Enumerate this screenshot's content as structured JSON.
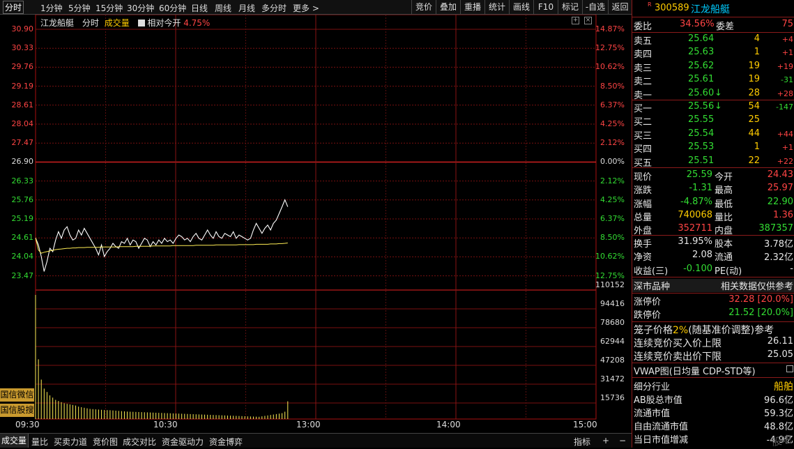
{
  "toolbar": {
    "tabs": [
      "分时",
      "1分钟",
      "5分钟",
      "15分钟",
      "30分钟",
      "60分钟",
      "日线",
      "周线",
      "月线",
      "多分时",
      "更多 >"
    ],
    "right": [
      "竞价",
      "叠加",
      "重播",
      "统计",
      "画线",
      "F10",
      "标记",
      "-自选",
      "返回"
    ]
  },
  "chart_header": {
    "name": "江龙船艇",
    "mode": "分时",
    "volume_label": "成交量",
    "relative_label": "相对今开",
    "relative_value": "4.75%"
  },
  "price_axis": [
    "30.90",
    "30.33",
    "29.76",
    "29.19",
    "28.61",
    "28.04",
    "27.47",
    "26.90",
    "26.33",
    "25.76",
    "25.19",
    "24.61",
    "24.04",
    "23.47"
  ],
  "pct_axis": [
    "14.87%",
    "12.75%",
    "10.62%",
    "8.50%",
    "6.37%",
    "4.25%",
    "2.12%",
    "0.00%",
    "2.12%",
    "4.25%",
    "6.37%",
    "8.50%",
    "10.62%",
    "12.75%"
  ],
  "volume_axis": [
    "110152",
    "94416",
    "78680",
    "62944",
    "47208",
    "31472",
    "15736"
  ],
  "time_axis": [
    "09:30",
    "10:30",
    "13:00",
    "14:00",
    "15:00"
  ],
  "side_buttons": [
    "国信微信",
    "国信股搜"
  ],
  "bottom_tabs": [
    "成交量",
    "量比",
    "买卖力道",
    "竞价图",
    "成交对比",
    "资金驱动力",
    "资金博弈"
  ],
  "bottom_right": [
    "指标",
    "+",
    "−"
  ],
  "chart_data": {
    "type": "line",
    "x_range": [
      "09:30",
      "15:00"
    ],
    "ylim": [
      23.47,
      30.9
    ],
    "prev_close": 26.9,
    "series": [
      {
        "values": [
          24.61,
          24.4,
          24.05,
          23.6,
          23.9,
          24.3,
          24.2,
          24.55,
          24.8,
          24.6,
          24.85,
          24.95,
          24.7,
          24.55,
          24.6,
          24.85,
          24.7,
          24.9,
          24.75,
          24.6,
          24.45,
          24.3,
          24.1,
          24.4,
          24.05,
          24.2,
          24.3,
          24.45,
          24.35,
          24.3,
          24.5,
          24.45,
          24.6,
          24.4,
          24.55,
          24.5,
          24.3,
          24.45,
          24.6,
          24.55,
          24.35,
          24.5,
          24.4,
          24.55,
          24.45,
          24.6,
          24.5,
          24.55,
          24.45,
          24.6,
          24.7,
          24.65,
          24.55,
          24.6,
          24.5,
          24.65,
          24.75,
          24.6,
          24.55,
          24.7,
          24.85,
          24.7,
          24.6,
          24.8,
          24.65,
          24.6,
          24.75,
          24.7,
          24.65,
          24.8,
          24.6,
          24.7,
          24.65,
          24.6,
          24.55,
          24.6,
          24.85,
          25.05,
          24.9,
          24.75,
          24.9,
          25.0,
          24.85,
          25.05,
          25.15,
          25.35,
          25.55,
          25.76,
          25.55
        ]
      },
      {
        "values": [
          24.61,
          24.25,
          24.15,
          24.18,
          24.2,
          24.22,
          24.24,
          24.26,
          24.27,
          24.28,
          24.29,
          24.3,
          24.3,
          24.31,
          24.31,
          24.32,
          24.32,
          24.32,
          24.33,
          24.33,
          24.33,
          24.33,
          24.33,
          24.34,
          24.34,
          24.34,
          24.34,
          24.34,
          24.34,
          24.35,
          24.35,
          24.35,
          24.35,
          24.35,
          24.35,
          24.36,
          24.36,
          24.36,
          24.36,
          24.36,
          24.36,
          24.37,
          24.37,
          24.37,
          24.37,
          24.37,
          24.37,
          24.37,
          24.38,
          24.38,
          24.38,
          24.38,
          24.38,
          24.38,
          24.38,
          24.38,
          24.39,
          24.39,
          24.39,
          24.39,
          24.39,
          24.39,
          24.39,
          24.4,
          24.4,
          24.4,
          24.4,
          24.4,
          24.4,
          24.4,
          24.4,
          24.41,
          24.41,
          24.41,
          24.41,
          24.41,
          24.41,
          24.42,
          24.42,
          24.42,
          24.42,
          24.42,
          24.43,
          24.43,
          24.43,
          24.44,
          24.44,
          24.45,
          24.46
        ]
      }
    ],
    "volume": [
      110152,
      53000,
      35000,
      27000,
      24000,
      21000,
      19000,
      17000,
      16000,
      15000,
      14000,
      13500,
      13000,
      12500,
      12000,
      11000,
      10500,
      10000,
      9500,
      9000,
      8800,
      8600,
      8400,
      8200,
      8000,
      7900,
      7800,
      7600,
      7400,
      7200,
      7000,
      6800,
      6600,
      6500,
      6400,
      6300,
      6200,
      6100,
      6000,
      5900,
      5800,
      5700,
      5600,
      5500,
      5400,
      5300,
      5200,
      5100,
      5000,
      4900,
      4800,
      4700,
      4600,
      4500,
      4400,
      4300,
      4200,
      4100,
      4000,
      3900,
      3800,
      3700,
      3600,
      3500,
      3400,
      3300,
      3200,
      3100,
      3000,
      2900,
      2800,
      2700,
      2600,
      2500,
      2400,
      2300,
      2200,
      2100,
      2000,
      2400,
      2800,
      3200,
      3600,
      4000,
      4400,
      4800,
      5200,
      6500,
      15736
    ],
    "ylim_volume": [
      0,
      110152
    ]
  },
  "panel": {
    "code_prefix": "R",
    "code": "300589",
    "name": "江龙船艇",
    "weibi_label": "委比",
    "weibi_value": "34.56%",
    "weicha_label": "委差",
    "weicha_value": "75",
    "sells": [
      {
        "label": "卖五",
        "price": "25.64",
        "vol": "4",
        "chg": "+4"
      },
      {
        "label": "卖四",
        "price": "25.63",
        "vol": "1",
        "chg": "+1"
      },
      {
        "label": "卖三",
        "price": "25.62",
        "vol": "19",
        "chg": "+19"
      },
      {
        "label": "卖二",
        "price": "25.61",
        "vol": "19",
        "chg": "-31"
      },
      {
        "label": "卖一",
        "price": "25.60",
        "vol": "28",
        "chg": "+28",
        "arrow": "↓"
      }
    ],
    "buys": [
      {
        "label": "买一",
        "price": "25.56",
        "vol": "54",
        "chg": "-147",
        "arrow": "↓"
      },
      {
        "label": "买二",
        "price": "25.55",
        "vol": "25",
        "chg": ""
      },
      {
        "label": "买三",
        "price": "25.54",
        "vol": "44",
        "chg": "+44"
      },
      {
        "label": "买四",
        "price": "25.53",
        "vol": "1",
        "chg": "+1"
      },
      {
        "label": "买五",
        "price": "25.51",
        "vol": "22",
        "chg": "+22"
      }
    ],
    "quote": [
      {
        "l1": "现价",
        "v1": "25.59",
        "l2": "今开",
        "v2": "24.43"
      },
      {
        "l1": "涨跌",
        "v1": "-1.31",
        "l2": "最高",
        "v2": "25.97"
      },
      {
        "l1": "涨幅",
        "v1": "-4.87%",
        "l2": "最低",
        "v2": "22.90"
      },
      {
        "l1": "总量",
        "v1": "740068",
        "l2": "量比",
        "v2": "1.36"
      },
      {
        "l1": "外盘",
        "v1": "352711",
        "l2": "内盘",
        "v2": "387357"
      }
    ],
    "finance": [
      {
        "l1": "换手",
        "v1": "31.95%",
        "l2": "股本",
        "v2": "3.78亿"
      },
      {
        "l1": "净资",
        "v1": "2.08",
        "l2": "流通",
        "v2": "2.32亿"
      },
      {
        "l1": "收益(三)",
        "v1": "-0.100",
        "l2": "PE(动)",
        "v2": "-"
      }
    ],
    "market_label": "深市品种",
    "ref_label": "相关数据仅供参考",
    "limit_up_label": "涨停价",
    "limit_up_value": "32.28 [20.0%]",
    "limit_down_label": "跌停价",
    "limit_down_value": "21.52 [20.0%]",
    "cage_label": "笼子价格",
    "cage_pct": "2%",
    "cage_rest": "(随基准价调整)参考",
    "bid_upper_label": "连续竞价买入价上限",
    "bid_upper_value": "26.11",
    "ask_lower_label": "连续竞价卖出价下限",
    "ask_lower_value": "25.05",
    "vwap_label": "VWAP图(日均量 CDP-STD等)",
    "industry_label": "细分行业",
    "industry_value": "船舶",
    "ab_label": "AB股总市值",
    "ab_value": "96.6亿",
    "float_label": "流通市值",
    "float_value": "59.3亿",
    "free_label": "自由流通市值",
    "free_value": "48.8亿",
    "daily_label": "当日市值增减",
    "daily_value": "-4.9亿",
    "watermark": "股吧"
  }
}
